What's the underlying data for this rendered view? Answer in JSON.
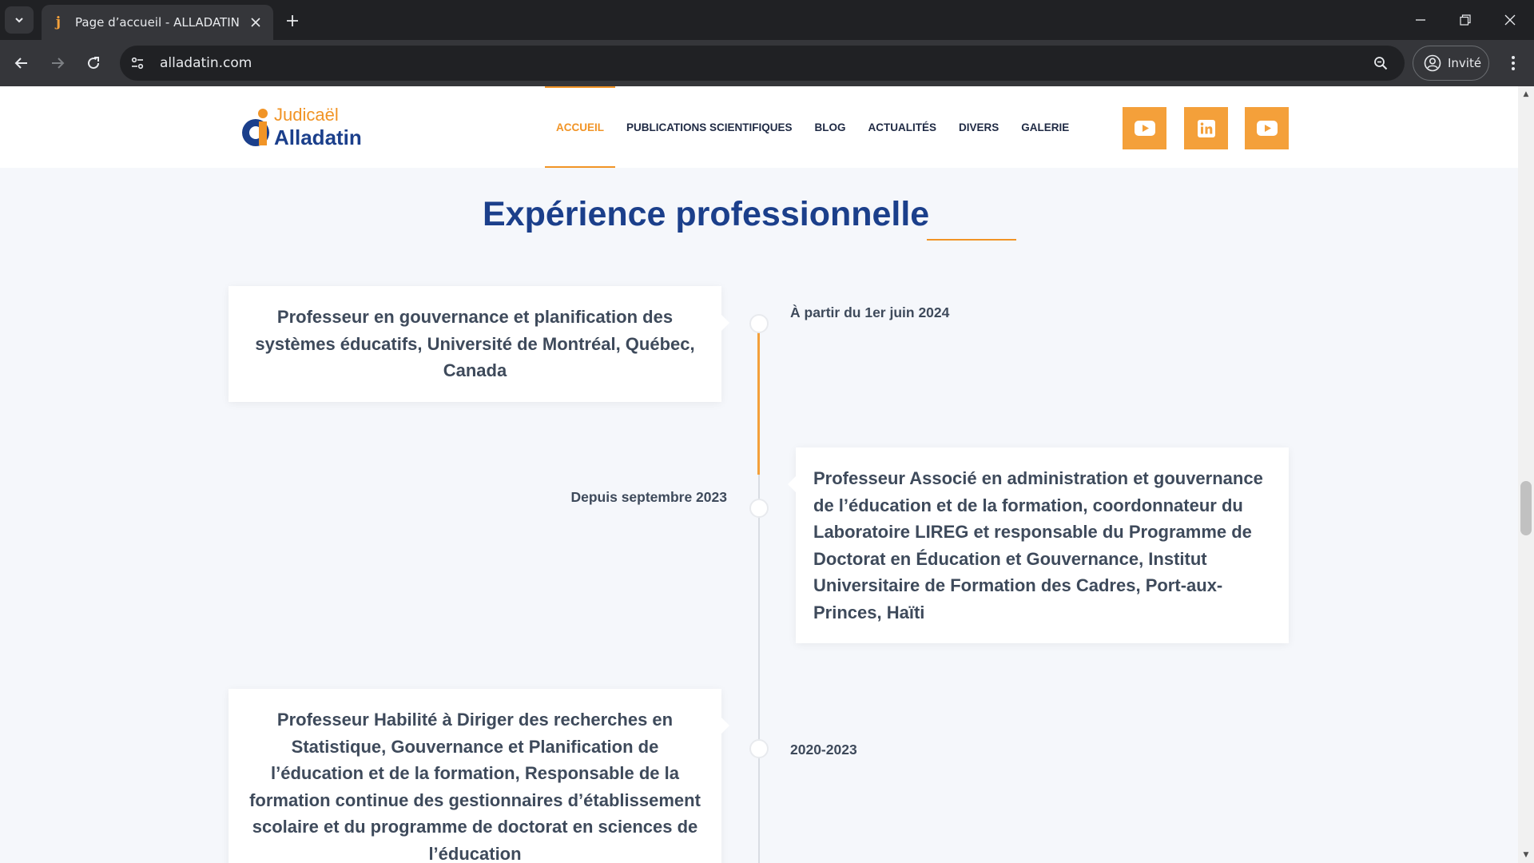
{
  "browser": {
    "tab_title": "Page d’accueil - ALLADATIN",
    "url": "alladatin.com",
    "profile_label": "Invité"
  },
  "site": {
    "logo_line1": "Judicaël",
    "logo_line2": "Alladatin",
    "nav": [
      "ACCUEIL",
      "PUBLICATIONS SCIENTIFIQUES",
      "BLOG",
      "ACTUALITÉS",
      "DIVERS",
      "GALERIE"
    ],
    "social": [
      {
        "icon": "youtube-icon"
      },
      {
        "icon": "linkedin-icon"
      },
      {
        "icon": "youtube-icon"
      }
    ]
  },
  "section": {
    "title": "Expérience professionnelle"
  },
  "timeline": [
    {
      "side": "left",
      "text": "Professeur en gouvernance et planification des systèmes éducatifs, Université de Montréal, Québec, Canada",
      "date": "À partir du 1er juin 2024"
    },
    {
      "side": "right",
      "text": "Professeur Associé en administration et gouvernance de l’éducation et de la formation, coordonnateur du Laboratoire LIREG et responsable du Programme de Doctorat en Éducation et Gouvernance, Institut Universitaire de Formation des Cadres, Port-aux-Princes, Haïti",
      "date": "Depuis septembre 2023"
    },
    {
      "side": "left",
      "text": "Professeur Habilité à Diriger des recherches en Statistique, Gouvernance et Planification de l’éducation et de la formation, Responsable de la formation continue des gestionnaires d’établissement scolaire et du programme de doctorat en sciences de l’éducation",
      "date": "2020-2023"
    }
  ],
  "colors": {
    "brand_blue": "#1b3f8b",
    "accent_orange": "#f19426",
    "social_orange": "#f4a03a"
  }
}
